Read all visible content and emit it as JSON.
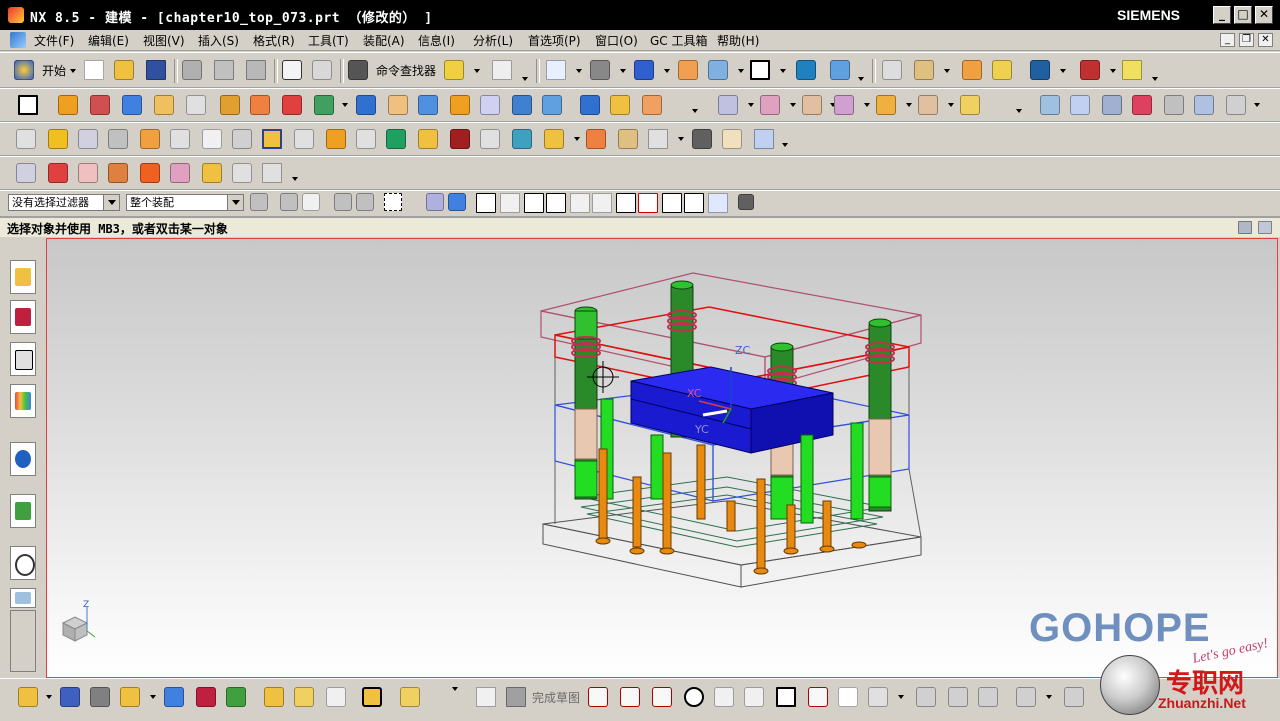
{
  "window": {
    "title": "NX 8.5 - 建模 - [chapter10_top_073.prt （修改的） ]",
    "brand": "SIEMENS",
    "controls": [
      "_",
      "□",
      "✕"
    ]
  },
  "menu": {
    "items": [
      "文件(F)",
      "编辑(E)",
      "视图(V)",
      "插入(S)",
      "格式(R)",
      "工具(T)",
      "装配(A)",
      "信息(I)",
      "分析(L)",
      "首选项(P)",
      "窗口(O)",
      "GC 工具箱",
      "帮助(H)"
    ],
    "mdi_controls": [
      "_",
      "❐",
      "✕"
    ]
  },
  "toolbar": {
    "start_label": "开始",
    "command_finder_label": "命令查找器"
  },
  "selection_bar": {
    "filter_value": "没有选择过滤器",
    "scope_value": "整个装配"
  },
  "cue_line": "选择对象并使用 MB3，或者双击某一对象",
  "viewport": {
    "wcs_labels": {
      "zc": "ZC",
      "xc": "XC",
      "yc": "YC"
    },
    "triad_label": "Z",
    "colors": {
      "border": "#e04040",
      "core": "#1818d8",
      "guide_pillar": "#2a8a2a",
      "ejector_pin": "#e88a10",
      "return_pin": "#22dd22"
    }
  },
  "watermark": {
    "brand": "GOHOPE",
    "slogan": "Let's go easy!"
  },
  "bottom_toolbar": {
    "finish_sketch_label": "完成草图"
  },
  "site_badge": {
    "cn": "专职网",
    "url": "Zhuanzhi.Net"
  }
}
